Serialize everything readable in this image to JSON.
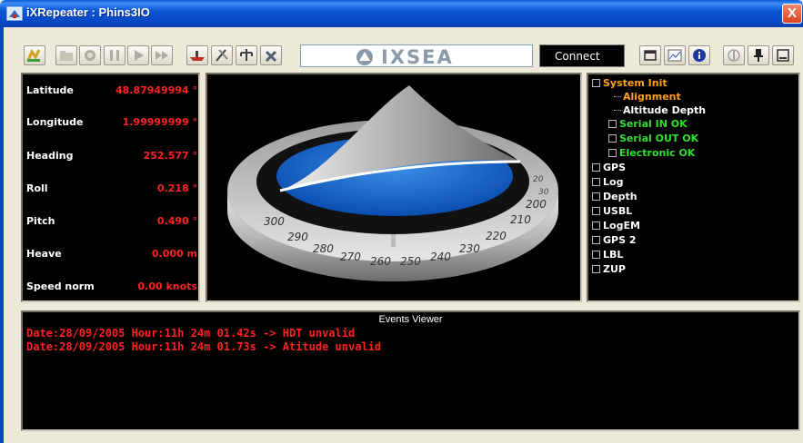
{
  "window": {
    "title": "iXRepeater : Phins3IO",
    "close_label": "X"
  },
  "toolbar": {
    "buttons": [
      "open-icon",
      "folder-icon",
      "record-icon",
      "pause-icon",
      "play-icon",
      "fast-forward-icon",
      "ship-icon",
      "tools-icon",
      "network-icon",
      "settings-icon",
      "window-icon",
      "chart-icon",
      "info-icon",
      "sound-icon",
      "pin-icon",
      "minimize-icon"
    ],
    "logo_text": "IXSEA",
    "connect_label": "Connect"
  },
  "navigation": {
    "rows": [
      {
        "label": "Latitude",
        "value": "48.87949994 °"
      },
      {
        "label": "Longitude",
        "value": "1.99999999 °"
      },
      {
        "label": "Heading",
        "value": "252.577 °"
      },
      {
        "label": "Roll",
        "value": "0.218 °"
      },
      {
        "label": "Pitch",
        "value": "0.490 °"
      },
      {
        "label": "Heave",
        "value": "0.000 m"
      },
      {
        "label": "Speed norm",
        "value": "0.00 knots"
      }
    ]
  },
  "compass": {
    "heading_ticks": [
      "200",
      "210",
      "220",
      "230",
      "240",
      "250",
      "260",
      "270",
      "280",
      "290",
      "300"
    ],
    "back_ticks": [
      "20",
      "30"
    ]
  },
  "status_tree": {
    "items": [
      {
        "label": "System Init",
        "color": "#ffa020",
        "level": 0,
        "checkbox": true
      },
      {
        "label": "Alignment",
        "color": "#ffa020",
        "level": 2,
        "checkbox": false
      },
      {
        "label": "Altitude Depth",
        "color": "#ffffff",
        "level": 2,
        "checkbox": false
      },
      {
        "label": "Serial IN OK",
        "color": "#30e030",
        "level": 1,
        "checkbox": true
      },
      {
        "label": "Serial OUT OK",
        "color": "#30e030",
        "level": 1,
        "checkbox": true
      },
      {
        "label": "Electronic OK",
        "color": "#30e030",
        "level": 1,
        "checkbox": true
      },
      {
        "label": "GPS",
        "color": "#ffffff",
        "level": 0,
        "checkbox": true
      },
      {
        "label": "Log",
        "color": "#ffffff",
        "level": 0,
        "checkbox": true
      },
      {
        "label": "Depth",
        "color": "#ffffff",
        "level": 0,
        "checkbox": true
      },
      {
        "label": "USBL",
        "color": "#ffffff",
        "level": 0,
        "checkbox": true
      },
      {
        "label": "LogEM",
        "color": "#ffffff",
        "level": 0,
        "checkbox": true
      },
      {
        "label": "GPS 2",
        "color": "#ffffff",
        "level": 0,
        "checkbox": true
      },
      {
        "label": "LBL",
        "color": "#ffffff",
        "level": 0,
        "checkbox": true
      },
      {
        "label": "ZUP",
        "color": "#ffffff",
        "level": 0,
        "checkbox": true
      }
    ]
  },
  "events": {
    "title": "Events Viewer",
    "lines": [
      "Date:28/09/2005 Hour:11h 24m 01.42s -> HDT unvalid",
      "Date:28/09/2005 Hour:11h 24m 01.73s -> Atitude unvalid"
    ]
  },
  "colors": {
    "value_red": "#ff2020",
    "ok_green": "#30e030",
    "init_orange": "#ffa020",
    "titlebar_blue": "#0a55d6"
  }
}
